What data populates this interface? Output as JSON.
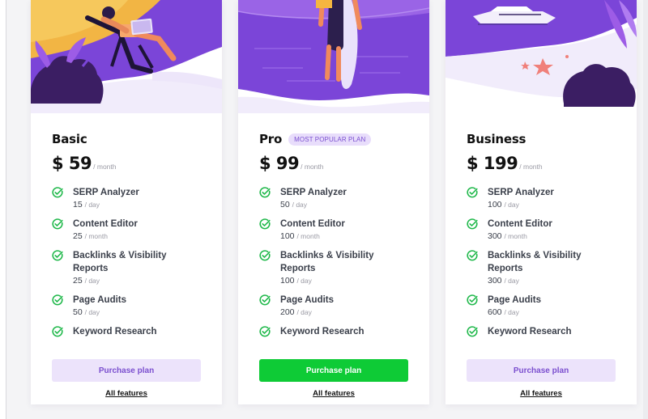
{
  "colors": {
    "accent": "#7a4fd0",
    "art_purple": "#7b45d8",
    "check_green": "#1fb84a",
    "primary_button": "#0ecb36",
    "light_button": "#ece3fb"
  },
  "plans": [
    {
      "title": "Basic",
      "badge": "",
      "price": "$ 59",
      "period": "/ month",
      "features": [
        {
          "name": "SERP Analyzer",
          "qty": "15",
          "unit": "/ day"
        },
        {
          "name": "Content Editor",
          "qty": "25",
          "unit": "/ month"
        },
        {
          "name": "Backlinks & Visibility Reports",
          "qty": "25",
          "unit": "/ day"
        },
        {
          "name": "Page Audits",
          "qty": "50",
          "unit": "/ day"
        },
        {
          "name": "Keyword Research",
          "qty": "",
          "unit": ""
        }
      ],
      "button_label": "Purchase plan",
      "button_style": "light",
      "link_label": "All features",
      "art": "beach-chair-laptop-illustration"
    },
    {
      "title": "Pro",
      "badge": "MOST POPULAR PLAN",
      "price": "$ 99",
      "period": "/ month",
      "features": [
        {
          "name": "SERP Analyzer",
          "qty": "50",
          "unit": "/ day"
        },
        {
          "name": "Content Editor",
          "qty": "100",
          "unit": "/ month"
        },
        {
          "name": "Backlinks & Visibility Reports",
          "qty": "100",
          "unit": "/ day"
        },
        {
          "name": "Page Audits",
          "qty": "200",
          "unit": "/ day"
        },
        {
          "name": "Keyword Research",
          "qty": "",
          "unit": ""
        }
      ],
      "button_label": "Purchase plan",
      "button_style": "primary",
      "link_label": "All features",
      "art": "surfer-illustration"
    },
    {
      "title": "Business",
      "badge": "",
      "price": "$ 199",
      "period": "/ month",
      "features": [
        {
          "name": "SERP Analyzer",
          "qty": "100",
          "unit": "/ day"
        },
        {
          "name": "Content Editor",
          "qty": "300",
          "unit": "/ month"
        },
        {
          "name": "Backlinks & Visibility Reports",
          "qty": "300",
          "unit": "/ day"
        },
        {
          "name": "Page Audits",
          "qty": "600",
          "unit": "/ day"
        },
        {
          "name": "Keyword Research",
          "qty": "",
          "unit": ""
        }
      ],
      "button_label": "Purchase plan",
      "button_style": "light",
      "link_label": "All features",
      "art": "yacht-starfish-illustration"
    }
  ]
}
